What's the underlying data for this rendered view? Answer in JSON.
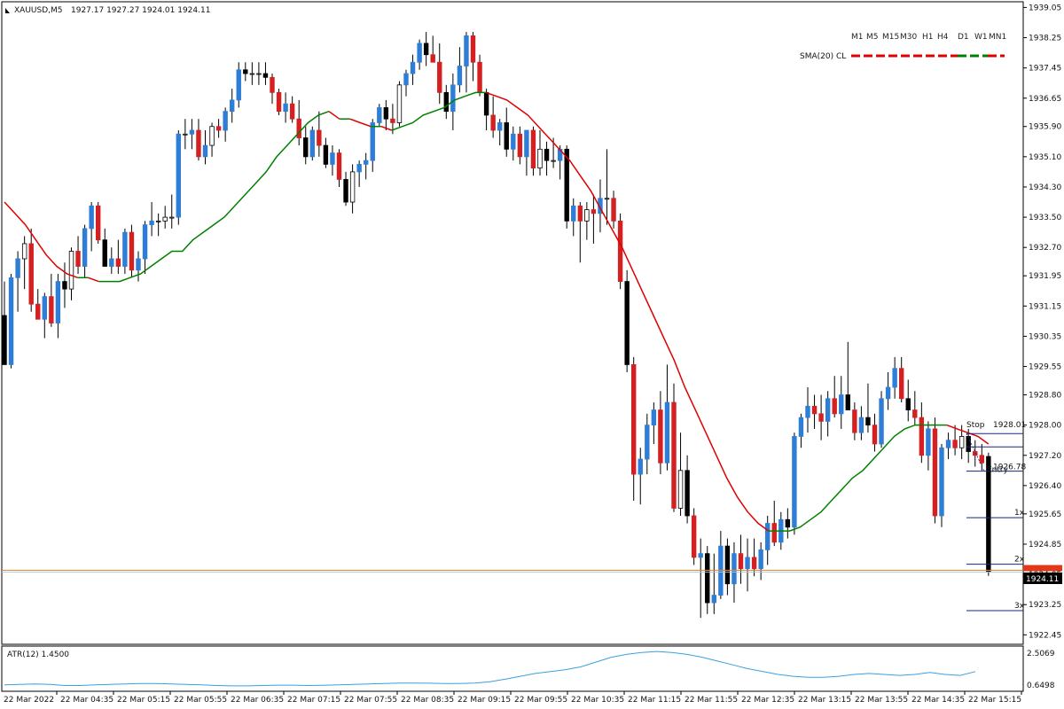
{
  "header": {
    "symbol": "XAUUSD,M5",
    "ohlc": "1927.17 1927.27 1924.01 1924.11"
  },
  "timeframes": [
    "M1",
    "M5",
    "M15",
    "M30",
    "H1",
    "H4",
    "D1",
    "W1",
    "MN1"
  ],
  "sma_legend": {
    "label": "SMA(20) CL",
    "up_color": "#008000",
    "down_color": "#e00000"
  },
  "atr": {
    "label": "ATR(12) 1.4500",
    "max_label": "2.5069",
    "min_label": "0.6498",
    "color": "#3aa0e0"
  },
  "current_price": "1924.11",
  "trade_lines": {
    "stop_label": "Stop",
    "stop_value": "1928.01",
    "entry_label": "Entry",
    "entry_value": "1926.78",
    "target_1": "1x",
    "target_2": "2x",
    "target_3": "3x"
  },
  "chart_data": {
    "type": "candlestick",
    "price_axis": [
      "1939.05",
      "1938.25",
      "1937.45",
      "1936.65",
      "1935.90",
      "1935.10",
      "1934.30",
      "1933.50",
      "1932.70",
      "1931.95",
      "1931.15",
      "1930.35",
      "1929.55",
      "1928.80",
      "1928.00",
      "1927.20",
      "1926.40",
      "1925.65",
      "1924.85",
      "1924.05",
      "1923.25",
      "1922.45"
    ],
    "time_axis": [
      "22 Mar 2022",
      "22 Mar 04:35",
      "22 Mar 05:15",
      "22 Mar 05:55",
      "22 Mar 06:35",
      "22 Mar 07:15",
      "22 Mar 07:55",
      "22 Mar 08:35",
      "22 Mar 09:15",
      "22 Mar 09:55",
      "22 Mar 10:35",
      "22 Mar 11:15",
      "22 Mar 11:55",
      "22 Mar 12:35",
      "22 Mar 13:15",
      "22 Mar 13:55",
      "22 Mar 14:35",
      "22 Mar 15:15"
    ],
    "ylim": [
      1922.2,
      1939.2
    ],
    "candles": [
      [
        1930.9,
        1931.8,
        1929.7,
        1929.6
      ],
      [
        1929.6,
        1932.0,
        1929.5,
        1931.9
      ],
      [
        1931.9,
        1932.6,
        1931.0,
        1932.4
      ],
      [
        1932.4,
        1933.0,
        1931.6,
        1932.8
      ],
      [
        1932.8,
        1933.2,
        1931.0,
        1931.2
      ],
      [
        1931.2,
        1931.6,
        1930.9,
        1930.8
      ],
      [
        1930.8,
        1931.5,
        1930.3,
        1931.4
      ],
      [
        1931.4,
        1932.0,
        1930.6,
        1930.7
      ],
      [
        1930.7,
        1932.0,
        1930.3,
        1931.8
      ],
      [
        1931.8,
        1932.3,
        1931.1,
        1931.6
      ],
      [
        1931.6,
        1932.7,
        1931.3,
        1932.6
      ],
      [
        1932.6,
        1933.0,
        1932.0,
        1932.2
      ],
      [
        1932.2,
        1933.3,
        1931.9,
        1933.2
      ],
      [
        1933.2,
        1933.9,
        1932.6,
        1933.8
      ],
      [
        1933.8,
        1933.9,
        1932.8,
        1932.9
      ],
      [
        1932.9,
        1933.2,
        1932.2,
        1932.2
      ],
      [
        1932.2,
        1932.7,
        1932.0,
        1932.4
      ],
      [
        1932.4,
        1932.9,
        1932.0,
        1932.2
      ],
      [
        1932.2,
        1933.2,
        1932.0,
        1933.1
      ],
      [
        1933.1,
        1933.3,
        1931.9,
        1932.1
      ],
      [
        1932.1,
        1932.6,
        1931.8,
        1932.4
      ],
      [
        1932.4,
        1933.4,
        1932.0,
        1933.3
      ],
      [
        1933.3,
        1933.9,
        1933.0,
        1933.4
      ],
      [
        1933.4,
        1933.6,
        1933.0,
        1933.4
      ],
      [
        1933.4,
        1933.8,
        1933.2,
        1933.5
      ],
      [
        1933.5,
        1934.1,
        1933.2,
        1933.5
      ],
      [
        1933.5,
        1935.8,
        1933.3,
        1935.7
      ],
      [
        1935.7,
        1936.1,
        1935.3,
        1935.7
      ],
      [
        1935.7,
        1936.1,
        1935.3,
        1935.8
      ],
      [
        1935.8,
        1936.1,
        1935.0,
        1935.1
      ],
      [
        1935.1,
        1935.8,
        1934.9,
        1935.4
      ],
      [
        1935.4,
        1936.0,
        1935.1,
        1935.9
      ],
      [
        1935.9,
        1936.1,
        1935.6,
        1935.8
      ],
      [
        1935.8,
        1936.4,
        1935.5,
        1936.3
      ],
      [
        1936.3,
        1936.9,
        1936.0,
        1936.6
      ],
      [
        1936.6,
        1937.6,
        1936.4,
        1937.4
      ],
      [
        1937.4,
        1937.6,
        1937.1,
        1937.3
      ],
      [
        1937.3,
        1937.6,
        1937.0,
        1937.3
      ],
      [
        1937.3,
        1937.6,
        1937.0,
        1937.3
      ],
      [
        1937.3,
        1937.6,
        1937.0,
        1937.2
      ],
      [
        1937.2,
        1937.3,
        1936.5,
        1936.8
      ],
      [
        1936.8,
        1936.9,
        1936.2,
        1936.3
      ],
      [
        1936.3,
        1936.8,
        1936.0,
        1936.5
      ],
      [
        1936.5,
        1936.7,
        1936.0,
        1936.1
      ],
      [
        1936.1,
        1936.6,
        1935.4,
        1935.6
      ],
      [
        1935.6,
        1935.9,
        1934.9,
        1935.1
      ],
      [
        1935.1,
        1935.9,
        1935.0,
        1935.8
      ],
      [
        1935.8,
        1936.3,
        1935.1,
        1935.4
      ],
      [
        1935.4,
        1935.6,
        1934.8,
        1934.9
      ],
      [
        1934.9,
        1935.4,
        1934.6,
        1935.2
      ],
      [
        1935.2,
        1935.3,
        1934.3,
        1934.5
      ],
      [
        1934.5,
        1934.7,
        1933.8,
        1933.9
      ],
      [
        1933.9,
        1934.9,
        1933.6,
        1934.7
      ],
      [
        1934.7,
        1935.0,
        1934.3,
        1934.9
      ],
      [
        1934.9,
        1935.2,
        1934.5,
        1935.0
      ],
      [
        1935.0,
        1936.1,
        1934.7,
        1936.0
      ],
      [
        1936.0,
        1936.5,
        1935.9,
        1936.4
      ],
      [
        1936.4,
        1936.6,
        1935.8,
        1936.1
      ],
      [
        1936.1,
        1936.5,
        1935.7,
        1936.0
      ],
      [
        1936.0,
        1937.1,
        1935.9,
        1937.0
      ],
      [
        1937.0,
        1937.4,
        1936.7,
        1937.3
      ],
      [
        1937.3,
        1937.8,
        1937.0,
        1937.6
      ],
      [
        1937.6,
        1938.2,
        1937.4,
        1938.1
      ],
      [
        1938.1,
        1938.4,
        1937.5,
        1937.8
      ],
      [
        1937.8,
        1938.3,
        1937.6,
        1937.6
      ],
      [
        1937.6,
        1938.1,
        1936.5,
        1936.8
      ],
      [
        1936.8,
        1937.0,
        1936.1,
        1936.3
      ],
      [
        1936.3,
        1937.3,
        1935.8,
        1937.0
      ],
      [
        1937.0,
        1938.0,
        1936.8,
        1937.5
      ],
      [
        1937.5,
        1938.4,
        1936.8,
        1938.3
      ],
      [
        1938.3,
        1938.4,
        1937.1,
        1937.6
      ],
      [
        1937.6,
        1937.8,
        1936.7,
        1936.8
      ],
      [
        1936.8,
        1936.9,
        1935.8,
        1936.2
      ],
      [
        1936.2,
        1936.7,
        1935.6,
        1935.8
      ],
      [
        1935.8,
        1936.1,
        1935.4,
        1936.0
      ],
      [
        1936.0,
        1936.4,
        1935.1,
        1935.3
      ],
      [
        1935.3,
        1935.9,
        1935.0,
        1935.7
      ],
      [
        1935.7,
        1935.9,
        1934.9,
        1935.1
      ],
      [
        1935.1,
        1935.8,
        1934.6,
        1935.8
      ],
      [
        1935.8,
        1935.9,
        1934.6,
        1934.8
      ],
      [
        1934.8,
        1935.8,
        1934.6,
        1935.3
      ],
      [
        1935.3,
        1935.5,
        1934.6,
        1935.0
      ],
      [
        1935.0,
        1935.6,
        1934.8,
        1935.0
      ],
      [
        1935.0,
        1935.4,
        1934.5,
        1935.3
      ],
      [
        1935.3,
        1935.4,
        1933.2,
        1933.4
      ],
      [
        1933.4,
        1934.0,
        1933.0,
        1933.8
      ],
      [
        1933.8,
        1933.9,
        1932.3,
        1933.4
      ],
      [
        1933.4,
        1933.9,
        1932.9,
        1933.7
      ],
      [
        1933.7,
        1934.1,
        1932.8,
        1933.6
      ],
      [
        1933.6,
        1934.5,
        1933.1,
        1934.0
      ],
      [
        1934.0,
        1935.3,
        1933.3,
        1934.0
      ],
      [
        1934.0,
        1934.2,
        1933.2,
        1933.4
      ],
      [
        1933.4,
        1933.6,
        1931.6,
        1931.8
      ],
      [
        1931.8,
        1932.1,
        1929.4,
        1929.6
      ],
      [
        1929.6,
        1929.8,
        1926.0,
        1926.7
      ],
      [
        1926.7,
        1927.4,
        1925.9,
        1927.1
      ],
      [
        1927.1,
        1928.3,
        1926.7,
        1928.0
      ],
      [
        1928.0,
        1928.6,
        1927.5,
        1928.4
      ],
      [
        1928.4,
        1928.9,
        1926.7,
        1927.0
      ],
      [
        1927.0,
        1929.6,
        1926.8,
        1928.6
      ],
      [
        1928.6,
        1929.1,
        1925.7,
        1925.8
      ],
      [
        1925.8,
        1927.8,
        1925.6,
        1926.8
      ],
      [
        1926.8,
        1927.2,
        1925.4,
        1925.6
      ],
      [
        1925.6,
        1925.8,
        1924.3,
        1924.5
      ],
      [
        1924.5,
        1925.0,
        1922.9,
        1924.6
      ],
      [
        1924.6,
        1924.8,
        1923.0,
        1923.3
      ],
      [
        1923.3,
        1924.6,
        1923.0,
        1923.5
      ],
      [
        1923.5,
        1925.2,
        1923.4,
        1924.8
      ],
      [
        1924.8,
        1925.0,
        1923.5,
        1923.8
      ],
      [
        1923.8,
        1924.9,
        1923.3,
        1924.6
      ],
      [
        1924.6,
        1925.1,
        1923.8,
        1924.2
      ],
      [
        1924.2,
        1925.0,
        1923.6,
        1924.5
      ],
      [
        1924.5,
        1925.0,
        1924.0,
        1924.2
      ],
      [
        1924.2,
        1924.9,
        1923.9,
        1924.7
      ],
      [
        1924.7,
        1925.6,
        1924.3,
        1925.4
      ],
      [
        1925.4,
        1926.0,
        1924.8,
        1924.9
      ],
      [
        1924.9,
        1925.7,
        1924.7,
        1925.5
      ],
      [
        1925.5,
        1925.8,
        1925.0,
        1925.3
      ],
      [
        1925.3,
        1927.8,
        1925.1,
        1927.7
      ],
      [
        1927.7,
        1928.3,
        1927.4,
        1928.2
      ],
      [
        1928.2,
        1929.0,
        1927.8,
        1928.5
      ],
      [
        1928.5,
        1928.8,
        1927.9,
        1928.3
      ],
      [
        1928.3,
        1928.8,
        1927.6,
        1928.1
      ],
      [
        1928.1,
        1928.9,
        1927.7,
        1928.7
      ],
      [
        1928.7,
        1929.3,
        1928.2,
        1928.3
      ],
      [
        1928.3,
        1929.3,
        1927.9,
        1928.8
      ],
      [
        1928.8,
        1930.2,
        1928.5,
        1928.4
      ],
      [
        1928.4,
        1928.6,
        1927.6,
        1927.8
      ],
      [
        1927.8,
        1928.5,
        1927.6,
        1928.2
      ],
      [
        1928.2,
        1929.1,
        1927.8,
        1928.0
      ],
      [
        1928.0,
        1928.3,
        1927.3,
        1927.5
      ],
      [
        1927.5,
        1928.9,
        1927.4,
        1928.7
      ],
      [
        1928.7,
        1929.4,
        1928.4,
        1929.0
      ],
      [
        1929.0,
        1929.8,
        1928.7,
        1929.5
      ],
      [
        1929.5,
        1929.8,
        1928.6,
        1928.7
      ],
      [
        1928.7,
        1929.2,
        1928.1,
        1928.4
      ],
      [
        1928.4,
        1928.9,
        1928.0,
        1928.2
      ],
      [
        1928.2,
        1928.6,
        1927.0,
        1927.2
      ],
      [
        1927.2,
        1928.1,
        1926.8,
        1927.9
      ],
      [
        1927.9,
        1928.2,
        1925.4,
        1925.6
      ],
      [
        1925.6,
        1927.5,
        1925.3,
        1927.4
      ],
      [
        1927.4,
        1927.8,
        1927.1,
        1927.6
      ],
      [
        1927.6,
        1928.0,
        1927.2,
        1927.4
      ],
      [
        1927.4,
        1928.0,
        1927.1,
        1927.7
      ],
      [
        1927.7,
        1927.9,
        1927.0,
        1927.3
      ],
      [
        1927.3,
        1927.6,
        1926.9,
        1927.2
      ],
      [
        1927.2,
        1927.5,
        1926.8,
        1927.0
      ],
      [
        1927.17,
        1927.27,
        1924.01,
        1924.11
      ]
    ],
    "sma": [
      1933.9,
      1933.6,
      1933.3,
      1932.9,
      1932.5,
      1932.2,
      1932.0,
      1931.9,
      1931.9,
      1931.8,
      1931.8,
      1931.8,
      1931.9,
      1932.0,
      1932.2,
      1932.4,
      1932.6,
      1932.6,
      1932.9,
      1933.1,
      1933.3,
      1933.5,
      1933.8,
      1934.1,
      1934.4,
      1934.7,
      1935.1,
      1935.4,
      1935.7,
      1936.0,
      1936.2,
      1936.3,
      1936.1,
      1936.1,
      1936.0,
      1935.9,
      1935.9,
      1935.8,
      1935.9,
      1936.0,
      1936.2,
      1936.3,
      1936.4,
      1936.6,
      1936.7,
      1936.8,
      1936.8,
      1936.7,
      1936.6,
      1936.4,
      1936.2,
      1935.9,
      1935.6,
      1935.3,
      1935.0,
      1934.6,
      1934.2,
      1933.7,
      1933.2,
      1932.7,
      1932.1,
      1931.5,
      1930.9,
      1930.3,
      1929.7,
      1929.0,
      1928.4,
      1927.8,
      1927.2,
      1926.6,
      1926.1,
      1925.7,
      1925.4,
      1925.2,
      1925.2,
      1925.2,
      1925.3,
      1925.5,
      1925.7,
      1926.0,
      1926.3,
      1926.6,
      1926.8,
      1927.1,
      1927.4,
      1927.7,
      1927.9,
      1928.0,
      1928.0,
      1928.0,
      1928.0,
      1927.9,
      1927.8,
      1927.7,
      1927.5
    ],
    "atr_values": [
      0.75,
      0.78,
      0.8,
      0.78,
      0.72,
      0.72,
      0.75,
      0.78,
      0.8,
      0.82,
      0.82,
      0.8,
      0.78,
      0.75,
      0.72,
      0.7,
      0.7,
      0.72,
      0.74,
      0.74,
      0.72,
      0.73,
      0.75,
      0.78,
      0.8,
      0.82,
      0.85,
      0.85,
      0.84,
      0.82,
      0.82,
      0.85,
      0.92,
      1.05,
      1.2,
      1.35,
      1.45,
      1.55,
      1.7,
      1.95,
      2.2,
      2.35,
      2.45,
      2.5,
      2.45,
      2.35,
      2.2,
      2.0,
      1.8,
      1.6,
      1.45,
      1.3,
      1.2,
      1.15,
      1.15,
      1.2,
      1.3,
      1.35,
      1.3,
      1.25,
      1.3,
      1.4,
      1.3,
      1.25,
      1.45
    ]
  }
}
